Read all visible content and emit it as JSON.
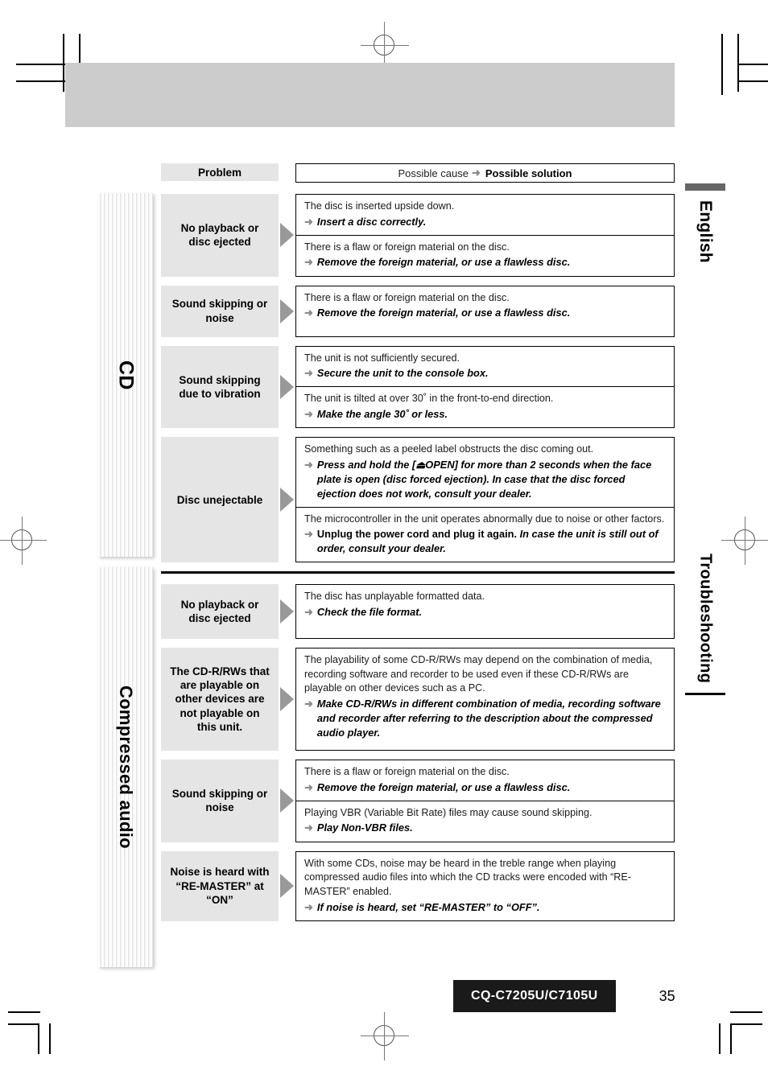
{
  "page": {
    "number": "35",
    "model": "CQ-C7205U/C7105U",
    "language_tab": "English",
    "section_tab": "Troubleshooting"
  },
  "table": {
    "header": {
      "problem": "Problem",
      "cause_lead": "Possible cause",
      "arrow": "➜",
      "solution": "Possible solution"
    },
    "solution_arrow": "➜"
  },
  "groups": [
    {
      "category": "CD",
      "rows": [
        {
          "problem": "No playback or\ndisc ejected",
          "causes": [
            {
              "cause": "The disc is inserted upside down.",
              "solution": "Insert a disc correctly."
            },
            {
              "cause": "There is a flaw or foreign material on the disc.",
              "solution": "Remove the foreign material, or use a flawless disc."
            }
          ]
        },
        {
          "problem": "Sound skipping or\nnoise",
          "causes": [
            {
              "cause": "There is a flaw or foreign material on the disc.",
              "solution": "Remove the foreign material, or use a flawless disc."
            }
          ]
        },
        {
          "problem": "Sound skipping\ndue to vibration",
          "causes": [
            {
              "cause": "The unit is not sufficiently secured.",
              "solution": "Secure the unit to the console box."
            },
            {
              "cause": "The unit is tilted at over 30˚ in the front-to-end direction.",
              "solution": "Make the angle 30˚ or less."
            }
          ]
        },
        {
          "problem": "Disc unejectable",
          "causes": [
            {
              "cause": "Something such as a peeled label obstructs the disc coming out.",
              "solution": "Press and hold the [⏏OPEN] for more than 2 seconds when the face plate is open (disc forced ejection). In case that the disc forced ejection does not work, consult your dealer."
            },
            {
              "cause": "The microcontroller in the unit operates abnormally due to noise or other factors.",
              "solution_bold": "Unplug the power cord and plug it again.",
              "solution_italic": "In case the unit is still out of order, consult your dealer."
            }
          ]
        }
      ]
    },
    {
      "category": "Compressed audio",
      "rows": [
        {
          "problem": "No playback or\ndisc ejected",
          "causes": [
            {
              "cause": "The disc has unplayable formatted data.",
              "solution": "Check the file format."
            }
          ]
        },
        {
          "problem": "The CD-R/RWs that\nare playable on\nother devices are\nnot playable on\nthis unit.",
          "causes": [
            {
              "cause": "The playability of some CD-R/RWs may depend on the combination of media, recording software and recorder to be used even if these CD-R/RWs are playable on other devices such as a PC.",
              "solution": "Make CD-R/RWs in different combination of media, recording software and recorder after referring to the description about the compressed audio player."
            }
          ]
        },
        {
          "problem": "Sound skipping or\nnoise",
          "causes": [
            {
              "cause": "There is a flaw or foreign material on the disc.",
              "solution": "Remove the foreign material, or use a flawless disc."
            },
            {
              "cause": "Playing VBR (Variable Bit Rate) files may cause sound skipping.",
              "solution": "Play Non-VBR files."
            }
          ]
        },
        {
          "problem": "Noise is heard with\n“RE-MASTER” at\n“ON”",
          "causes": [
            {
              "cause": "With some CDs, noise may be heard in the treble range when playing compressed audio files into which the CD tracks were encoded with “RE-MASTER” enabled.",
              "solution": "If noise is heard, set “RE-MASTER” to “OFF”."
            }
          ]
        }
      ]
    }
  ]
}
